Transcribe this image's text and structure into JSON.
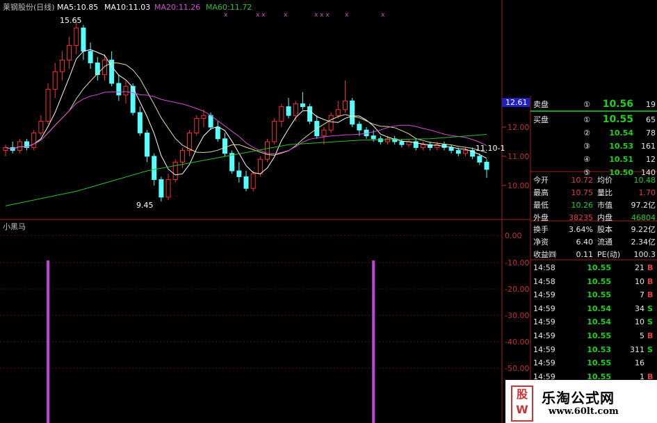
{
  "header": {
    "stock": "莱钢股份(日线)",
    "ma5": "MA5:10.85",
    "ma10": "MA10:11.03",
    "ma20": "MA20:11.26",
    "ma60": "MA60:11.72",
    "colors": {
      "stock": "#c0c0c0",
      "ma5": "#ffffff",
      "ma10": "#ffffff",
      "ma20": "#d050d0",
      "ma60": "#30c030"
    }
  },
  "annotations": {
    "high": "15.65",
    "low": "9.45",
    "last_ma": "11.10-1"
  },
  "price_axis": {
    "current_box": "12.61",
    "ticks": [
      "12.00",
      "11.00",
      "10.00"
    ]
  },
  "indicator": {
    "title": "小黑马",
    "axis_ticks": [
      "0.00",
      "-10.00",
      "-20.00",
      "-30.00",
      "-40.00",
      "-50.00"
    ]
  },
  "chart_data": {
    "type": "candlestick",
    "ylim": [
      9.0,
      16.0
    ],
    "candles": [
      [
        11.2,
        11.4,
        11.0,
        11.3
      ],
      [
        11.3,
        11.5,
        11.1,
        11.2
      ],
      [
        11.2,
        11.6,
        11.1,
        11.5
      ],
      [
        11.5,
        11.6,
        11.2,
        11.3
      ],
      [
        11.3,
        11.9,
        11.2,
        11.8
      ],
      [
        11.8,
        12.4,
        11.7,
        12.2
      ],
      [
        12.2,
        13.5,
        12.1,
        13.3
      ],
      [
        13.3,
        14.2,
        13.0,
        13.9
      ],
      [
        13.9,
        14.6,
        13.6,
        14.3
      ],
      [
        14.3,
        15.1,
        14.0,
        14.8
      ],
      [
        14.8,
        15.65,
        14.5,
        15.4
      ],
      [
        15.4,
        15.5,
        14.3,
        14.6
      ],
      [
        14.6,
        14.9,
        14.0,
        14.2
      ],
      [
        14.2,
        14.4,
        13.6,
        13.8
      ],
      [
        13.8,
        14.5,
        13.6,
        14.3
      ],
      [
        14.3,
        14.6,
        13.4,
        13.5
      ],
      [
        13.5,
        13.8,
        12.9,
        13.1
      ],
      [
        13.1,
        13.6,
        12.8,
        13.4
      ],
      [
        13.4,
        13.5,
        12.4,
        12.5
      ],
      [
        12.5,
        12.7,
        11.7,
        11.8
      ],
      [
        11.8,
        11.9,
        10.8,
        11.0
      ],
      [
        11.0,
        11.1,
        10.0,
        10.2
      ],
      [
        10.2,
        10.3,
        9.45,
        9.6
      ],
      [
        9.6,
        10.4,
        9.5,
        10.2
      ],
      [
        10.2,
        10.9,
        10.1,
        10.8
      ],
      [
        10.8,
        11.3,
        10.6,
        11.2
      ],
      [
        11.2,
        11.9,
        11.0,
        11.8
      ],
      [
        11.8,
        12.4,
        11.7,
        12.3
      ],
      [
        12.3,
        12.6,
        12.0,
        12.4
      ],
      [
        12.4,
        12.5,
        11.9,
        12.0
      ],
      [
        12.0,
        12.2,
        11.5,
        11.6
      ],
      [
        11.6,
        11.8,
        11.0,
        11.1
      ],
      [
        11.1,
        11.2,
        10.4,
        10.5
      ],
      [
        10.5,
        10.8,
        10.1,
        10.3
      ],
      [
        10.3,
        10.5,
        9.8,
        9.9
      ],
      [
        9.9,
        10.5,
        9.8,
        10.4
      ],
      [
        10.4,
        11.0,
        10.3,
        10.9
      ],
      [
        10.9,
        11.6,
        10.8,
        11.5
      ],
      [
        11.5,
        12.3,
        11.4,
        12.2
      ],
      [
        12.2,
        12.8,
        12.0,
        12.7
      ],
      [
        12.7,
        13.0,
        12.3,
        12.4
      ],
      [
        12.4,
        12.9,
        12.2,
        12.8
      ],
      [
        12.8,
        13.2,
        12.6,
        12.7
      ],
      [
        12.7,
        12.8,
        12.1,
        12.2
      ],
      [
        12.2,
        12.4,
        11.6,
        11.7
      ],
      [
        11.7,
        12.0,
        11.4,
        11.9
      ],
      [
        11.9,
        12.5,
        11.8,
        12.4
      ],
      [
        12.4,
        12.9,
        12.3,
        12.6
      ],
      [
        12.6,
        13.6,
        12.5,
        12.9
      ],
      [
        12.9,
        13.0,
        12.0,
        12.1
      ],
      [
        12.1,
        12.2,
        11.7,
        11.9
      ],
      [
        11.9,
        12.0,
        11.6,
        11.7
      ],
      [
        11.7,
        11.9,
        11.5,
        11.6
      ],
      [
        11.6,
        11.7,
        11.4,
        11.5
      ],
      [
        11.5,
        11.7,
        11.4,
        11.6
      ],
      [
        11.6,
        11.7,
        11.4,
        11.5
      ],
      [
        11.5,
        11.6,
        11.3,
        11.4
      ],
      [
        11.4,
        11.6,
        11.3,
        11.5
      ],
      [
        11.5,
        11.6,
        11.2,
        11.3
      ],
      [
        11.3,
        11.5,
        11.2,
        11.4
      ],
      [
        11.4,
        11.5,
        11.2,
        11.3
      ],
      [
        11.3,
        11.5,
        11.2,
        11.4
      ],
      [
        11.4,
        11.5,
        11.2,
        11.3
      ],
      [
        11.3,
        11.4,
        11.1,
        11.2
      ],
      [
        11.2,
        11.3,
        11.0,
        11.1
      ],
      [
        11.1,
        11.3,
        11.0,
        11.2
      ],
      [
        11.2,
        11.3,
        10.9,
        11.0
      ],
      [
        11.0,
        11.1,
        10.7,
        10.8
      ],
      [
        10.8,
        10.9,
        10.26,
        10.55
      ]
    ],
    "ma60_points": [
      [
        0,
        9.3
      ],
      [
        10,
        9.8
      ],
      [
        20,
        10.5
      ],
      [
        30,
        10.95
      ],
      [
        40,
        11.4
      ],
      [
        50,
        11.55
      ],
      [
        60,
        11.6
      ],
      [
        68,
        11.75
      ]
    ],
    "signal_positions": [
      6,
      52
    ]
  },
  "quotes": [
    {
      "key": "卖盘",
      "circ": "①",
      "price": "10.56",
      "vol": "19"
    },
    {
      "key": "买盘",
      "circ": "①",
      "price": "10.55",
      "vol": "65"
    },
    {
      "key": "",
      "circ": "②",
      "price": "10.54",
      "vol": "78"
    },
    {
      "key": "",
      "circ": "③",
      "price": "10.53",
      "vol": "161"
    },
    {
      "key": "",
      "circ": "④",
      "price": "10.51",
      "vol": "12"
    },
    {
      "key": "",
      "circ": "⑤",
      "price": "10.50",
      "vol": "140"
    }
  ],
  "stats": [
    {
      "l1": "今开",
      "v1": "10.72",
      "l2": "均价",
      "v2": "10.48"
    },
    {
      "l1": "最高",
      "v1": "10.75",
      "l2": "量比",
      "v2": "1.70"
    },
    {
      "l1": "最低",
      "v1": "10.26",
      "l2": "市值",
      "v2": "97.2亿"
    },
    {
      "l1": "外盘",
      "v1": "38235",
      "l2": "内盘",
      "v2": "46804"
    }
  ],
  "fund": [
    {
      "l1": "换手",
      "v1": "3.64%",
      "l2": "股本",
      "v2": "9.22亿"
    },
    {
      "l1": "净资",
      "v1": "6.40",
      "l2": "流通",
      "v2": "2.34亿"
    },
    {
      "l1": "收益㈣",
      "v1": "0.11",
      "l2": "PE(动)",
      "v2": "100.3"
    }
  ],
  "ticks": [
    {
      "t": "14:58",
      "p": "10.55",
      "v": "21",
      "d": "B"
    },
    {
      "t": "14:58",
      "p": "10.55",
      "v": "10",
      "d": "B"
    },
    {
      "t": "14:59",
      "p": "10.55",
      "v": "7",
      "d": "B"
    },
    {
      "t": "14:59",
      "p": "10.54",
      "v": "34",
      "d": "S"
    },
    {
      "t": "14:59",
      "p": "10.54",
      "v": "10",
      "d": "S"
    },
    {
      "t": "14:59",
      "p": "10.55",
      "v": "5",
      "d": "B"
    },
    {
      "t": "14:59",
      "p": "10.53",
      "v": "311",
      "d": "S"
    },
    {
      "t": "14:59",
      "p": "10.55",
      "v": "16",
      "d": ""
    },
    {
      "t": "14:59",
      "p": "10.55",
      "v": "1",
      "d": "B"
    },
    {
      "t": "14:59",
      "p": "10.54",
      "v": "12",
      "d": "S"
    }
  ],
  "watermark": {
    "logo": "股 W",
    "title": "乐淘公式网",
    "url": "www.60lt.com"
  }
}
